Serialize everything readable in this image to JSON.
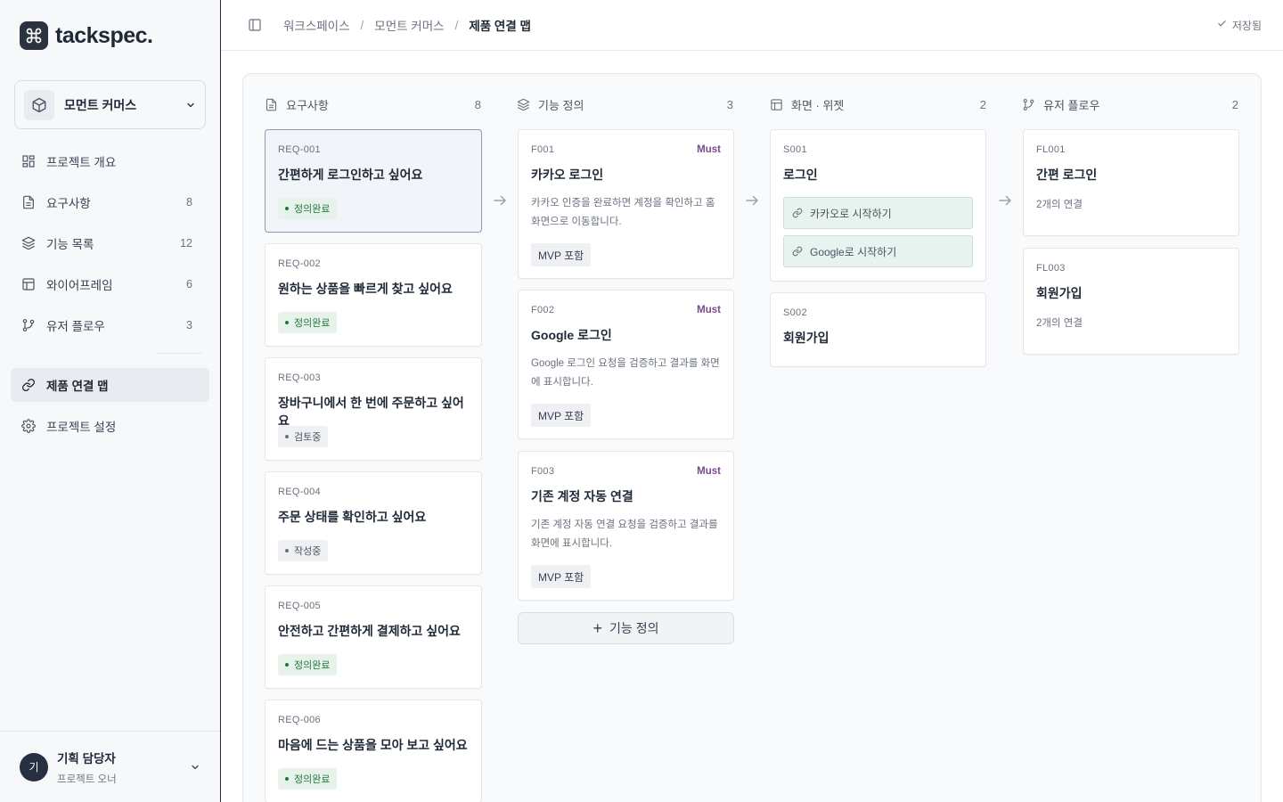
{
  "brand": {
    "name": "tackspec."
  },
  "project": {
    "name": "모먼트 커머스"
  },
  "sidebar": {
    "items": [
      {
        "label": "프로젝트 개요",
        "count": ""
      },
      {
        "label": "요구사항",
        "count": "8"
      },
      {
        "label": "기능 목록",
        "count": "12"
      },
      {
        "label": "와이어프레임",
        "count": "6"
      },
      {
        "label": "유저 플로우",
        "count": "3"
      },
      {
        "label": "제품 연결 맵",
        "count": ""
      },
      {
        "label": "프로젝트 설정",
        "count": ""
      }
    ]
  },
  "user": {
    "initial": "기",
    "name": "기획 담당자",
    "role": "프로젝트 오너"
  },
  "breadcrumb": [
    "워크스페이스",
    "모먼트 커머스",
    "제품 연결 맵"
  ],
  "breadcrumb_sep": "/",
  "status": {
    "saved": "저장됨"
  },
  "columns": [
    {
      "title": "요구사항",
      "count": "8"
    },
    {
      "title": "기능 정의",
      "count": "3"
    },
    {
      "title": "화면 · 위젯",
      "count": "2"
    },
    {
      "title": "유저 플로우",
      "count": "2"
    }
  ],
  "requirements": [
    {
      "id": "REQ-001",
      "title": "간편하게 로그인하고 싶어요",
      "status": "정의완료"
    },
    {
      "id": "REQ-002",
      "title": "원하는 상품을 빠르게 찾고 싶어요",
      "status": "정의완료"
    },
    {
      "id": "REQ-003",
      "title": "장바구니에서 한 번에 주문하고 싶어요",
      "status": "검토중"
    },
    {
      "id": "REQ-004",
      "title": "주문 상태를 확인하고 싶어요",
      "status": "작성중"
    },
    {
      "id": "REQ-005",
      "title": "안전하고 간편하게 결제하고 싶어요",
      "status": "정의완료"
    },
    {
      "id": "REQ-006",
      "title": "마음에 드는 상품을 모아 보고 싶어요",
      "status": "정의완료"
    }
  ],
  "features": [
    {
      "id": "F001",
      "priority": "Must",
      "title": "카카오 로그인",
      "desc": "카카오 인증을 완료하면 계정을 확인하고 홈 화면으로 이동합니다.",
      "tag": "MVP 포함"
    },
    {
      "id": "F002",
      "priority": "Must",
      "title": "Google 로그인",
      "desc": "Google 로그인 요청을 검증하고 결과를 화면에 표시합니다.",
      "tag": "MVP 포함"
    },
    {
      "id": "F003",
      "priority": "Must",
      "title": "기존 계정 자동 연결",
      "desc": "기존 계정 자동 연결 요청을 검증하고 결과를 화면에 표시합니다.",
      "tag": "MVP 포함"
    }
  ],
  "add_feature_label": "기능 정의",
  "screens": [
    {
      "id": "S001",
      "title": "로그인",
      "widgets": [
        "카카오로 시작하기",
        "Google로 시작하기"
      ]
    },
    {
      "id": "S002",
      "title": "회원가입",
      "widgets": []
    }
  ],
  "flows": [
    {
      "id": "FL001",
      "title": "간편 로그인",
      "links": "2개의 연결"
    },
    {
      "id": "FL003",
      "title": "회원가입",
      "links": "2개의 연결"
    }
  ],
  "colors": {
    "accent": "#2b3340",
    "done": "#1f7a3c",
    "must": "#7c4a8e",
    "widget_bg": "#e8f2ee"
  }
}
